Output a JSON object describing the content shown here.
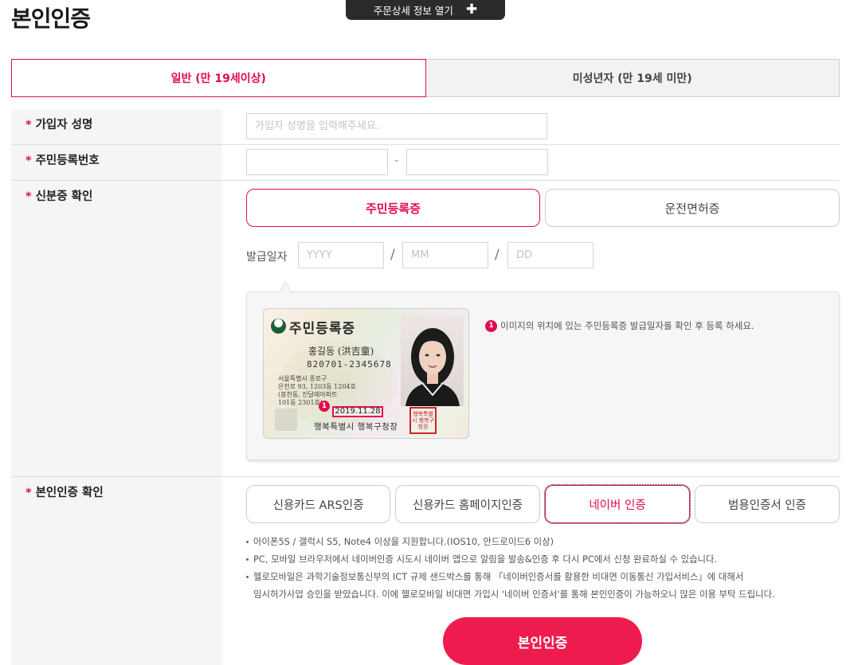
{
  "page": {
    "title": "본인인증"
  },
  "order_toggle": {
    "label": "주문상세 정보 열기",
    "icon": "plus-icon",
    "icon_glyph": "✚"
  },
  "tabs": [
    {
      "label": "일반 (만 19세이상)",
      "active": true
    },
    {
      "label": "미성년자 (만 19세 미만)",
      "active": false
    }
  ],
  "form": {
    "required_mark": "*",
    "name": {
      "label": "가입자 성명",
      "placeholder": "가입자 성명을 입력해주세요.",
      "value": ""
    },
    "rrn": {
      "label": "주민등록번호",
      "separator": "-",
      "first_value": "",
      "second_value": ""
    },
    "id_check": {
      "label": "신분증 확인",
      "options": [
        {
          "label": "주민등록증",
          "selected": true
        },
        {
          "label": "운전면허증",
          "selected": false
        }
      ],
      "issue_date": {
        "label": "발급일자",
        "separator": "/",
        "year_placeholder": "YYYY",
        "month_placeholder": "MM",
        "day_placeholder": "DD"
      },
      "guide": {
        "note_number": "1",
        "note": "이미지의 위치에 있는 주민등록증 발급일자를 확인 후 등록 하세요.",
        "card": {
          "title": "주민등록증",
          "name": "홍길동 (洪吉童)",
          "number": "820701-2345678",
          "address_lines": [
            "서울특별시 종로구",
            "은천로 93, 1203동 1204호",
            "(봉천동, 진달래아파트",
            "101동 2301호)"
          ],
          "issue_date": "2019.11.28",
          "issuer": "행복특별시 행복구청장",
          "stamp": "행복특별시 행복구청장",
          "badge": "1"
        }
      }
    },
    "auth": {
      "label": "본인인증 확인",
      "options": [
        {
          "label": "신용카드 ARS인증",
          "selected": false
        },
        {
          "label": "신용카드 홈페이지인증",
          "selected": false
        },
        {
          "label": "네이버 인증",
          "selected": true
        },
        {
          "label": "범용인증서 인증",
          "selected": false
        }
      ],
      "notes": [
        "아이폰5S / 갤럭시 S5, Note4 이상을 지원합니다.(IOS10, 안드로이드6 이상)",
        "PC, 모바일 브라우저에서 네이버인증 시도시 네이버 앱으로 알림을 발송&인증 후 다시 PC에서 신청 완료하실 수 있습니다.",
        "헬로모바일은 과학기술정보통신부의 ICT 규제 샌드박스를 통해 「네이버인증서를 활용한 비대면 이동통신 가입서비스」에 대해서"
      ],
      "note_continuation": "임시허가사업 승인을 받았습니다. 이에 헬로모바일 비대면 가입시 '네이버 인증서'를 통해 본인인증이 가능하오니 많은 이용 부탁 드립니다."
    },
    "submit_label": "본인인증"
  },
  "colors": {
    "accent": "#e30b4f",
    "submit_bg": "#ee1c4e",
    "label_col_bg": "#f5f5f5",
    "toggle_bg": "#2b2b2b"
  }
}
